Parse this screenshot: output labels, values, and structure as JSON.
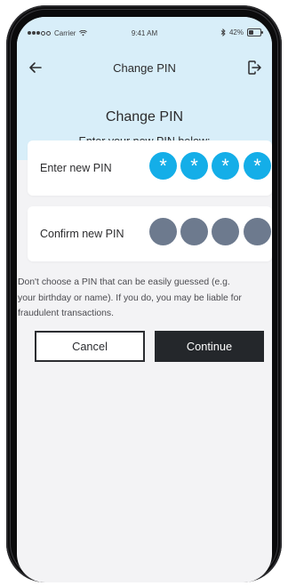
{
  "status_bar": {
    "carrier": "Carrier",
    "time": "9:41 AM",
    "battery_percent": "42%",
    "battery_level": 0.42
  },
  "nav": {
    "title": "Change PIN",
    "back_icon": "arrow-left-icon",
    "logout_icon": "logout-icon"
  },
  "header": {
    "headline": "Change PIN",
    "subheadline": "Enter your new PIN below:"
  },
  "pin_entry": {
    "label": "Enter new PIN",
    "mask_glyph": "*",
    "filled_digits": 4
  },
  "pin_confirm": {
    "label": "Confirm new PIN",
    "filled_digits": 0
  },
  "disclaimer": "Don't choose a PIN that can be easily guessed (e.g. your birthday or name). If you do, you may be liable for fraudulent transactions.",
  "actions": {
    "cancel_label": "Cancel",
    "continue_label": "Continue"
  },
  "colors": {
    "header_bg": "#d8eef9",
    "pin_filled": "#14aee8",
    "pin_empty": "#6d7a8e",
    "primary_button": "#24272b"
  }
}
